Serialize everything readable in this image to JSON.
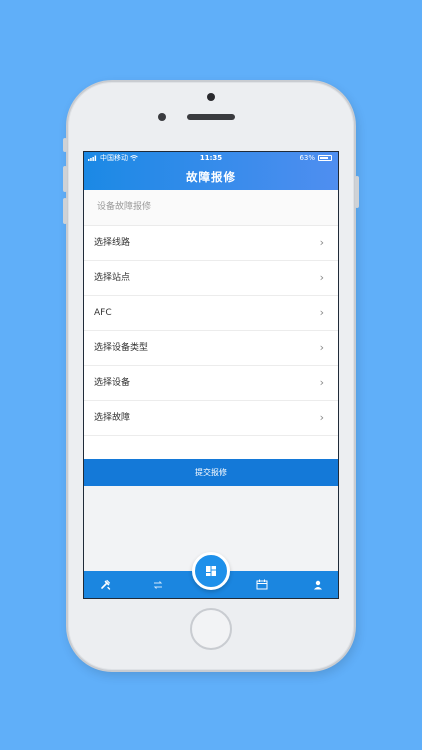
{
  "status_bar": {
    "carrier": "中国移动",
    "time": "11:35",
    "battery": "63%"
  },
  "nav": {
    "title": "故障报修"
  },
  "section_title": "设备故障报修",
  "rows": [
    {
      "label": "选择线路"
    },
    {
      "label": "选择站点"
    },
    {
      "label": "AFC"
    },
    {
      "label": "选择设备类型"
    },
    {
      "label": "选择设备"
    },
    {
      "label": "选择故障"
    }
  ],
  "submit_label": "提交报修",
  "tabbar": {
    "tabs": [
      {
        "icon": "wrench-icon"
      },
      {
        "icon": "swap-icon"
      },
      {
        "icon": "dashboard-icon"
      },
      {
        "icon": "calendar-icon"
      },
      {
        "icon": "user-icon"
      }
    ]
  },
  "colors": {
    "background": "#60aff9",
    "primary": "#1479d8",
    "header_gradient_start": "#1b89e5",
    "header_gradient_end": "#4f8ef0"
  }
}
